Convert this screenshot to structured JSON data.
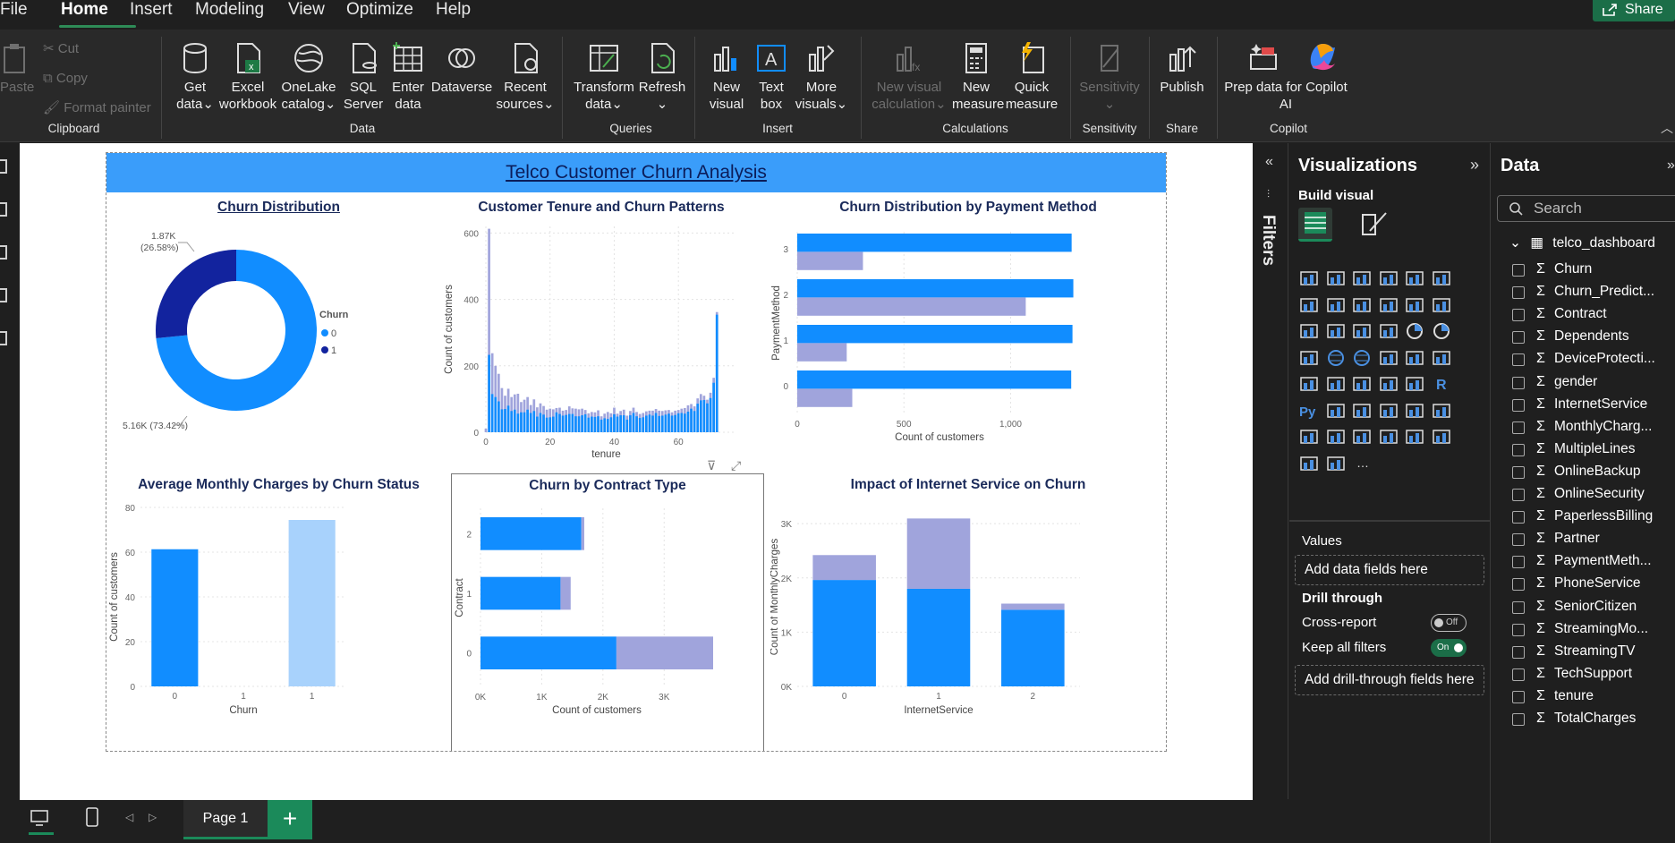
{
  "menu": {
    "items": [
      "File",
      "Home",
      "Insert",
      "Modeling",
      "View",
      "Optimize",
      "Help"
    ],
    "active": "Home",
    "share": "Share"
  },
  "ribbon": {
    "clipboard": {
      "paste": "Paste",
      "cut": "Cut",
      "copy": "Copy",
      "format_painter": "Format painter",
      "group": "Clipboard"
    },
    "data": {
      "get_data": [
        "Get",
        "data"
      ],
      "excel": [
        "Excel",
        "workbook"
      ],
      "onelake": [
        "OneLake",
        "catalog"
      ],
      "sql": [
        "SQL",
        "Server"
      ],
      "enter": [
        "Enter",
        "data"
      ],
      "dataverse": "Dataverse",
      "recent": [
        "Recent",
        "sources"
      ],
      "group": "Data"
    },
    "queries": {
      "transform": [
        "Transform",
        "data"
      ],
      "refresh": "Refresh",
      "group": "Queries"
    },
    "insert": {
      "new_visual": [
        "New",
        "visual"
      ],
      "text_box": [
        "Text",
        "box"
      ],
      "more_visuals": [
        "More",
        "visuals"
      ],
      "group": "Insert"
    },
    "calculations": {
      "new_visual_calc": [
        "New visual",
        "calculation"
      ],
      "new_measure": [
        "New",
        "measure"
      ],
      "quick_measure": [
        "Quick",
        "measure"
      ],
      "group": "Calculations"
    },
    "sensitivity": {
      "label": "Sensitivity",
      "group": "Sensitivity"
    },
    "share": {
      "publish": "Publish",
      "group": "Share"
    },
    "copilot": {
      "prep": [
        "Prep data for Copilot",
        "AI"
      ],
      "group": "Copilot"
    }
  },
  "report": {
    "title": "Telco Customer Churn Analysis",
    "visuals": {
      "donut_title": "Churn Distribution",
      "tenure_title": "Customer Tenure and Churn Patterns",
      "payment_title": "Churn Distribution by Payment Method",
      "monthly_title": "Average Monthly Charges by Churn Status",
      "contract_title": "Churn by Contract Type",
      "internet_title": "Impact of Internet Service on Churn"
    }
  },
  "chart_data": [
    {
      "type": "pie",
      "title": "Churn Distribution",
      "legend_title": "Churn",
      "categories": [
        "0",
        "1"
      ],
      "values": [
        5160,
        1870
      ],
      "labels": [
        "5.16K (73.42%)",
        "1.87K (26.58%)"
      ],
      "colors": [
        "#118dff",
        "#12239e"
      ]
    },
    {
      "type": "bar",
      "title": "Customer Tenure and Churn Patterns",
      "xlabel": "tenure",
      "ylabel": "Count of customers",
      "xticks": [
        "0",
        "20",
        "40",
        "60"
      ],
      "yticks": [
        "0",
        "200",
        "400",
        "600"
      ],
      "ylim": [
        0,
        620
      ],
      "series": [
        {
          "name": "0",
          "values": [
            0,
            233,
            115,
            106,
            93,
            69,
            70,
            80,
            64,
            68,
            56,
            60,
            60,
            68,
            58,
            64,
            47,
            58,
            53,
            44,
            45,
            47,
            60,
            55,
            50,
            52,
            55,
            55,
            48,
            48,
            51,
            54,
            44,
            47,
            46,
            48,
            38,
            42,
            40,
            45,
            54,
            47,
            51,
            51,
            38,
            51,
            58,
            48,
            43,
            45,
            50,
            53,
            50,
            58,
            49,
            50,
            53,
            56,
            50,
            52,
            57,
            58,
            56,
            62,
            71,
            64,
            86,
            96,
            97,
            87,
            103,
            149,
            354
          ]
        },
        {
          "name": "1",
          "values": [
            11,
            380,
            123,
            94,
            83,
            64,
            40,
            51,
            42,
            46,
            60,
            31,
            38,
            38,
            24,
            35,
            28,
            29,
            26,
            24,
            26,
            22,
            13,
            19,
            15,
            15,
            23,
            17,
            23,
            21,
            20,
            13,
            13,
            14,
            14,
            18,
            10,
            14,
            21,
            12,
            20,
            9,
            13,
            17,
            12,
            13,
            16,
            13,
            12,
            13,
            13,
            12,
            15,
            12,
            16,
            14,
            13,
            11,
            10,
            13,
            10,
            13,
            17,
            19,
            14,
            14,
            16,
            19,
            13,
            11,
            16,
            15,
            8
          ]
        }
      ]
    },
    {
      "type": "bar",
      "orientation": "horizontal",
      "title": "Churn Distribution by Payment Method",
      "xlabel": "Count of customers",
      "ylabel": "PaymentMethod",
      "categories": [
        "3",
        "2",
        "1",
        "0"
      ],
      "xticks": [
        "0",
        "500",
        "1,000"
      ],
      "xlim": [
        0,
        1300
      ],
      "series": [
        {
          "name": "0",
          "values": [
            1286,
            1294,
            1290,
            1284
          ]
        },
        {
          "name": "1",
          "values": [
            308,
            1071,
            232,
            258
          ]
        }
      ]
    },
    {
      "type": "bar",
      "title": "Average Monthly Charges by Churn Status",
      "xlabel": "Churn",
      "ylabel": "Count of customers",
      "categories": [
        "0",
        "1",
        "1"
      ],
      "yticks": [
        "0",
        "20",
        "40",
        "60",
        "80"
      ],
      "ylim": [
        0,
        80
      ],
      "values": [
        61.3,
        0,
        74.4
      ]
    },
    {
      "type": "bar",
      "orientation": "horizontal",
      "stacked": true,
      "title": "Churn by Contract Type",
      "xlabel": "Count of customers",
      "ylabel": "Contract",
      "categories": [
        "2",
        "1",
        "0"
      ],
      "xticks": [
        "0K",
        "1K",
        "2K",
        "3K"
      ],
      "xlim": [
        0,
        3800
      ],
      "series": [
        {
          "name": "0",
          "values": [
            1647,
            1307,
            2220
          ]
        },
        {
          "name": "1",
          "values": [
            48,
            166,
            1655
          ]
        }
      ]
    },
    {
      "type": "bar",
      "stacked": true,
      "title": "Impact of Internet Service on Churn",
      "xlabel": "InternetService",
      "ylabel": "Count of MonthlyCharges",
      "categories": [
        "0",
        "1",
        "2"
      ],
      "yticks": [
        "0K",
        "1K",
        "2K",
        "3K"
      ],
      "ylim": [
        0,
        3300
      ],
      "series": [
        {
          "name": "0",
          "values": [
            1962,
            1799,
            1413
          ]
        },
        {
          "name": "1",
          "values": [
            459,
            1297,
            113
          ]
        }
      ]
    }
  ],
  "filters": {
    "label": "Filters"
  },
  "visualizations": {
    "title": "Visualizations",
    "build": "Build visual",
    "values": "Values",
    "add_fields": "Add data fields here",
    "drill": "Drill through",
    "cross_report": "Cross-report",
    "cross_report_state": "Off",
    "keep_filters": "Keep all filters",
    "keep_filters_state": "On",
    "add_drill": "Add drill-through fields here"
  },
  "data_pane": {
    "title": "Data",
    "search_placeholder": "Search",
    "table": "telco_dashboard",
    "fields": [
      "Churn",
      "Churn_Predict...",
      "Contract",
      "Dependents",
      "DeviceProtecti...",
      "gender",
      "InternetService",
      "MonthlyCharg...",
      "MultipleLines",
      "OnlineBackup",
      "OnlineSecurity",
      "PaperlessBilling",
      "Partner",
      "PaymentMeth...",
      "PhoneService",
      "SeniorCitizen",
      "StreamingMo...",
      "StreamingTV",
      "TechSupport",
      "tenure",
      "TotalCharges"
    ]
  },
  "pages": {
    "tab": "Page 1",
    "add": "+"
  },
  "colors": {
    "blue": "#118dff",
    "light_purple": "#a0a4dc",
    "dark_navy": "#12239e",
    "green": "#1b8a5a"
  }
}
